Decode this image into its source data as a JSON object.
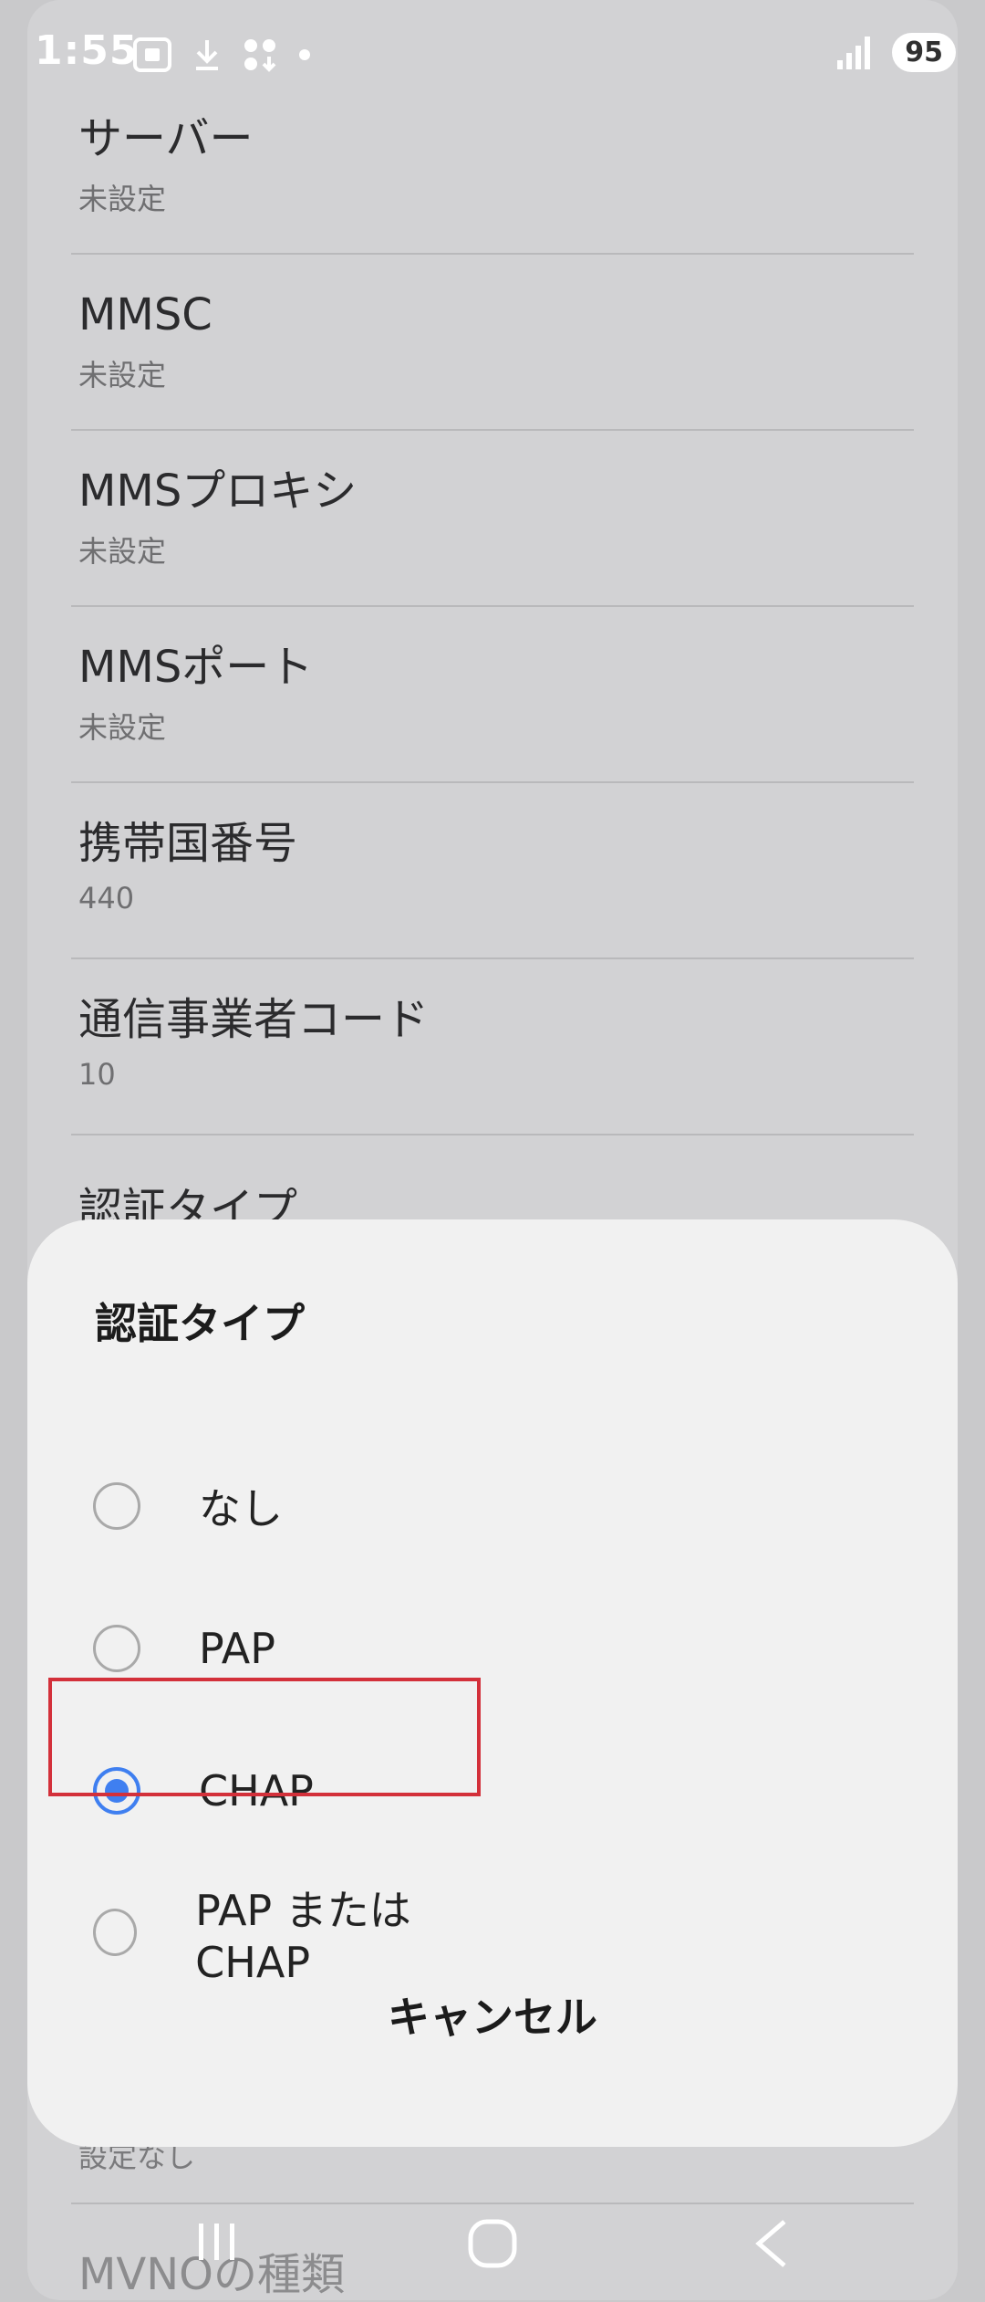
{
  "status_bar": {
    "time": "1:55",
    "battery": "95"
  },
  "settings": {
    "items": [
      {
        "title": "サーバー",
        "value": "未設定"
      },
      {
        "title": "MMSC",
        "value": "未設定"
      },
      {
        "title": "MMSプロキシ",
        "value": "未設定"
      },
      {
        "title": "MMSポート",
        "value": "未設定"
      },
      {
        "title": "携帯国番号",
        "value": "440"
      },
      {
        "title": "通信事業者コード",
        "value": "10"
      }
    ],
    "partial_title": "認証タイプ",
    "partial_bottom_sub": "設定なし",
    "partial_bottom_title": "MVNOの種類"
  },
  "dialog": {
    "title": "認証タイプ",
    "options": [
      {
        "label": "なし",
        "checked": false
      },
      {
        "label": "PAP",
        "checked": false
      },
      {
        "label": "CHAP",
        "checked": true
      },
      {
        "label": "PAP または CHAP",
        "checked": false
      }
    ],
    "cancel_label": "キャンセル"
  },
  "colors": {
    "accent": "#3f7ff0",
    "highlight": "#d3303a"
  }
}
